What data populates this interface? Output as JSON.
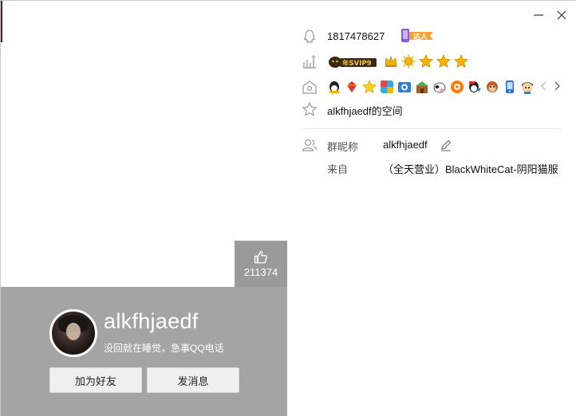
{
  "profile": {
    "nickname": "alkfhjaedf",
    "signature": "没回就在睡觉，急事QQ电话",
    "like_count": "211374",
    "add_friend_label": "加为好友",
    "send_message_label": "发消息"
  },
  "details": {
    "qq_number": "1817478627",
    "daren_badge_text": "达人",
    "svip_badge_text": "年SVIP9",
    "space_link": "alkfhjaedf的空间",
    "group_nickname_label": "群昵称",
    "group_nickname_value": "alkfhjaedf",
    "from_label": "来自",
    "from_value": "（全天营业）BlackWhiteCat-阴阳猫服"
  },
  "icons": {
    "qq": "qq-penguin-icon",
    "level": "level-chart-icon",
    "services": "house-icon",
    "space": "star-icon",
    "group": "group-members-icon",
    "like": "thumbs-up-icon",
    "edit": "pencil-icon",
    "minimize": "minimize-icon",
    "close": "close-icon"
  },
  "colors": {
    "card_background": "#a4a4a4",
    "like_background": "#9a9a9a",
    "level_star": "#f5b400",
    "svip_gold": "#e8b93a"
  },
  "level_icons": [
    "crown",
    "sun",
    "star",
    "star",
    "star"
  ],
  "service_badges": [
    "qq-vip",
    "red-diamond",
    "yellow-star",
    "app",
    "photo",
    "pet-house",
    "cow",
    "music",
    "penguin-game",
    "monkey",
    "phone",
    "character"
  ]
}
